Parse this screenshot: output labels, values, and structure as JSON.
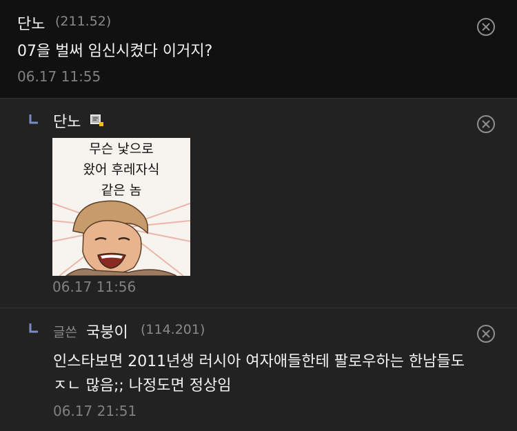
{
  "comments": [
    {
      "nickname": "단노",
      "ip": "(211.52)",
      "body": "07을 벌써 임신시켰다 이거지?",
      "time": "06.17 11:55",
      "delete_icon": "circle-x-icon"
    },
    {
      "nickname": "단노",
      "reply_icon": "reply-arrow-icon",
      "badge_icon": "gallery-member-icon",
      "image_caption_lines": [
        "무슨 낯으로",
        "왔어 후레자식",
        "같은 놈"
      ],
      "time": "06.17 11:56",
      "delete_icon": "circle-x-icon"
    },
    {
      "author_tag": "글쓴",
      "nickname": "국붕이",
      "ip": "(114.201)",
      "body_lines": [
        "인스타보면 2011년생 러시아 여자애들한테 팔로우하는 한남들도",
        "ㅈㄴ 많음;; 나정도면 정상임"
      ],
      "time": "06.17 21:51",
      "delete_icon": "circle-x-icon"
    }
  ],
  "colors": {
    "first_bg": "#111111",
    "reply_bg": "#222222",
    "reply_arrow": "#7b8cc4"
  }
}
